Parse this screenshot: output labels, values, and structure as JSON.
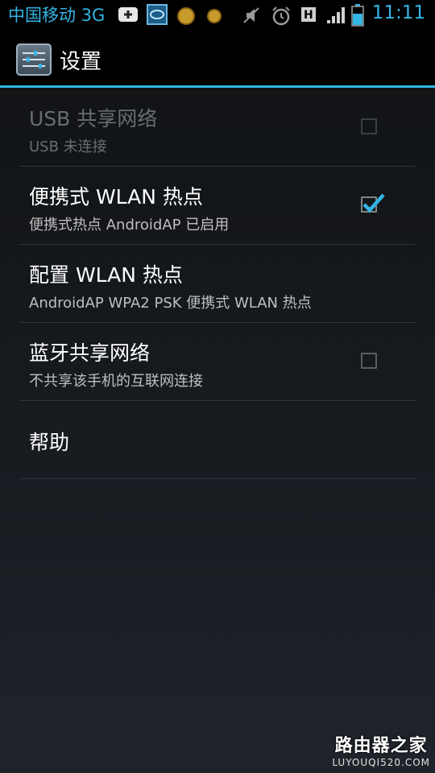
{
  "status_bar": {
    "carrier": "中国移动 3G",
    "time": "11:11",
    "icons": [
      "add-icon",
      "notification-app-icon",
      "coin-icon",
      "coin-icon",
      "mute-icon",
      "alarm-icon",
      "h-network-icon",
      "signal-icon",
      "battery-icon"
    ],
    "accent_color": "#33b5e5"
  },
  "action_bar": {
    "title": "设置",
    "icon": "settings-sliders-icon"
  },
  "items": [
    {
      "title": "USB 共享网络",
      "summary": "USB 未连接",
      "checkbox": "unchecked",
      "enabled": false
    },
    {
      "title": "便携式 WLAN 热点",
      "summary": "便携式热点 AndroidAP 已启用",
      "checkbox": "checked",
      "enabled": true
    },
    {
      "title": "配置 WLAN 热点",
      "summary": "AndroidAP WPA2 PSK 便携式 WLAN 热点",
      "enabled": true
    },
    {
      "title": "蓝牙共享网络",
      "summary": "不共享该手机的互联网连接",
      "checkbox": "unchecked",
      "enabled": true
    },
    {
      "title": "帮助",
      "enabled": true
    }
  ],
  "watermark": {
    "text": "路由器之家",
    "url": "LUYOUQI520.COM"
  }
}
